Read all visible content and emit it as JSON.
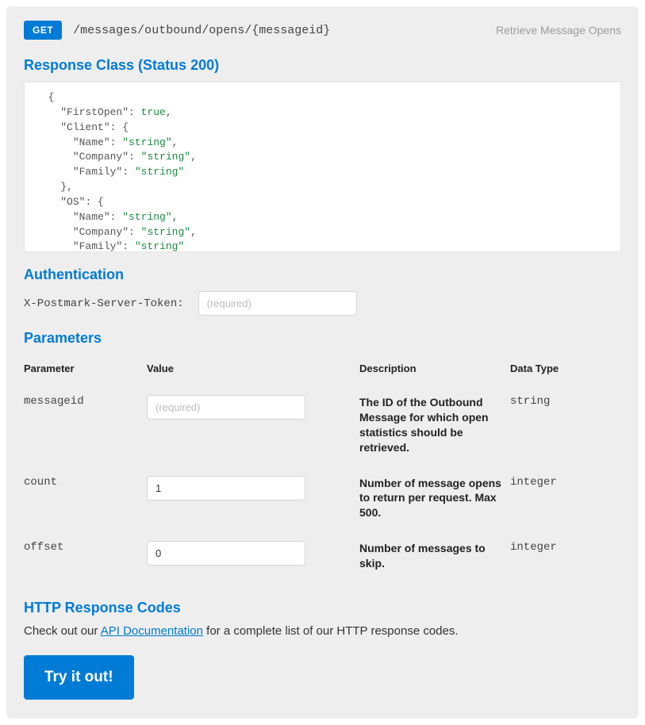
{
  "endpoint": {
    "method": "GET",
    "path": "/messages/outbound/opens/{messageid}",
    "summary": "Retrieve Message Opens"
  },
  "sections": {
    "response_class": "Response Class (Status 200)",
    "authentication": "Authentication",
    "parameters": "Parameters",
    "http_codes": "HTTP Response Codes"
  },
  "response_example": {
    "lines": [
      {
        "indent": 2,
        "tokens": [
          {
            "t": "punct",
            "v": "{"
          }
        ]
      },
      {
        "indent": 4,
        "tokens": [
          {
            "t": "key",
            "v": "\"FirstOpen\""
          },
          {
            "t": "punct",
            "v": ": "
          },
          {
            "t": "bool",
            "v": "true"
          },
          {
            "t": "punct",
            "v": ","
          }
        ]
      },
      {
        "indent": 4,
        "tokens": [
          {
            "t": "key",
            "v": "\"Client\""
          },
          {
            "t": "punct",
            "v": ": {"
          }
        ]
      },
      {
        "indent": 6,
        "tokens": [
          {
            "t": "key",
            "v": "\"Name\""
          },
          {
            "t": "punct",
            "v": ": "
          },
          {
            "t": "str",
            "v": "\"string\""
          },
          {
            "t": "punct",
            "v": ","
          }
        ]
      },
      {
        "indent": 6,
        "tokens": [
          {
            "t": "key",
            "v": "\"Company\""
          },
          {
            "t": "punct",
            "v": ": "
          },
          {
            "t": "str",
            "v": "\"string\""
          },
          {
            "t": "punct",
            "v": ","
          }
        ]
      },
      {
        "indent": 6,
        "tokens": [
          {
            "t": "key",
            "v": "\"Family\""
          },
          {
            "t": "punct",
            "v": ": "
          },
          {
            "t": "str",
            "v": "\"string\""
          }
        ]
      },
      {
        "indent": 4,
        "tokens": [
          {
            "t": "punct",
            "v": "},"
          }
        ]
      },
      {
        "indent": 4,
        "tokens": [
          {
            "t": "key",
            "v": "\"OS\""
          },
          {
            "t": "punct",
            "v": ": {"
          }
        ]
      },
      {
        "indent": 6,
        "tokens": [
          {
            "t": "key",
            "v": "\"Name\""
          },
          {
            "t": "punct",
            "v": ": "
          },
          {
            "t": "str",
            "v": "\"string\""
          },
          {
            "t": "punct",
            "v": ","
          }
        ]
      },
      {
        "indent": 6,
        "tokens": [
          {
            "t": "key",
            "v": "\"Company\""
          },
          {
            "t": "punct",
            "v": ": "
          },
          {
            "t": "str",
            "v": "\"string\""
          },
          {
            "t": "punct",
            "v": ","
          }
        ]
      },
      {
        "indent": 6,
        "tokens": [
          {
            "t": "key",
            "v": "\"Family\""
          },
          {
            "t": "punct",
            "v": ": "
          },
          {
            "t": "str",
            "v": "\"string\""
          }
        ]
      },
      {
        "indent": 4,
        "tokens": [
          {
            "t": "punct",
            "v": "}"
          }
        ]
      }
    ]
  },
  "auth": {
    "header_name": "X-Postmark-Server-Token:",
    "placeholder": "(required)"
  },
  "param_table": {
    "headers": {
      "parameter": "Parameter",
      "value": "Value",
      "description": "Description",
      "datatype": "Data Type"
    },
    "rows": [
      {
        "name": "messageid",
        "value": "",
        "placeholder": "(required)",
        "description": "The ID of the Outbound Message for which open statistics should be retrieved.",
        "type": "string"
      },
      {
        "name": "count",
        "value": "1",
        "placeholder": "",
        "description": "Number of message opens to return per request. Max 500.",
        "type": "integer"
      },
      {
        "name": "offset",
        "value": "0",
        "placeholder": "",
        "description": "Number of messages to skip.",
        "type": "integer"
      }
    ]
  },
  "http_codes": {
    "prefix": "Check out our ",
    "link_text": "API Documentation",
    "suffix": " for a complete list of our HTTP response codes."
  },
  "actions": {
    "try": "Try it out!"
  }
}
